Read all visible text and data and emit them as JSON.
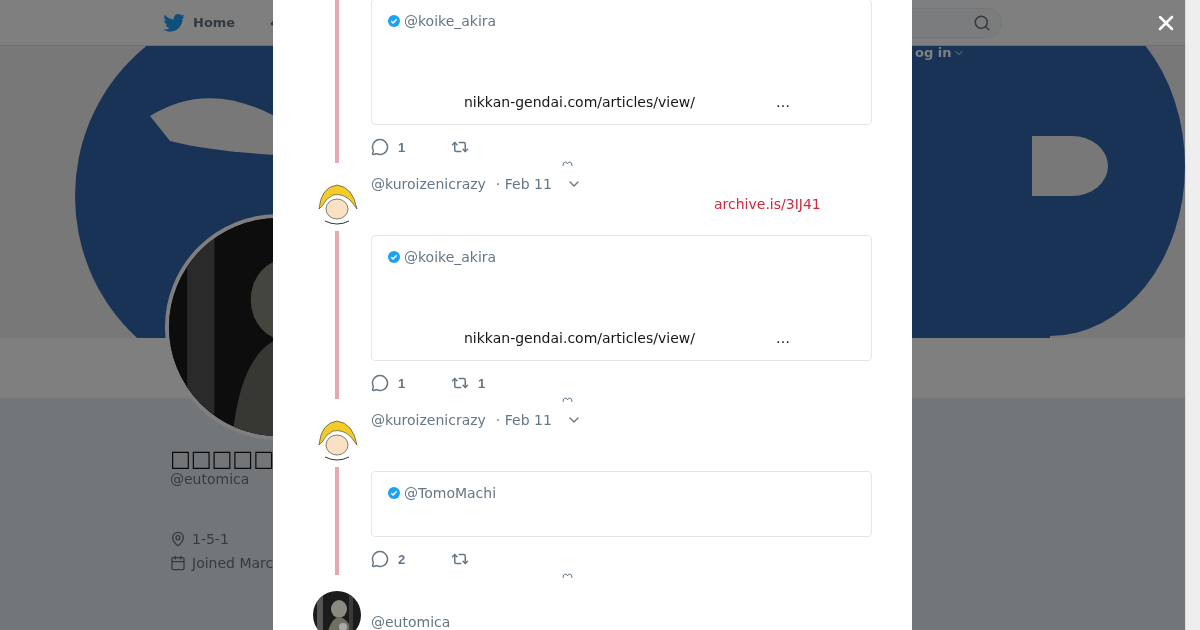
{
  "header": {
    "home_label": "Home",
    "login_label": "og in"
  },
  "profile": {
    "name": "□□□□□",
    "handle": "@eutomica",
    "location": "1-5-1",
    "joined": "Joined Marc"
  },
  "modal": {
    "tweets": [
      {
        "kind": "continued",
        "card": {
          "handle": "@koike_akira",
          "verified": true,
          "link": "nikkan-gendai.com/articles/view/",
          "more": "…"
        },
        "replies": "1"
      },
      {
        "kind": "reply",
        "handle": "@kuroizenicrazy",
        "date": "· Feb 11",
        "text": "archive.is/3IJ41",
        "card": {
          "handle": "@koike_akira",
          "verified": true,
          "link": "nikkan-gendai.com/articles/view/",
          "more": "…"
        },
        "replies": "1",
        "retweets": "1"
      },
      {
        "kind": "reply",
        "handle": "@kuroizenicrazy",
        "date": "· Feb 11",
        "card": {
          "handle": "@TomoMachi",
          "verified": true
        },
        "replies": "2"
      },
      {
        "kind": "main",
        "handle": "@eutomica"
      }
    ]
  }
}
